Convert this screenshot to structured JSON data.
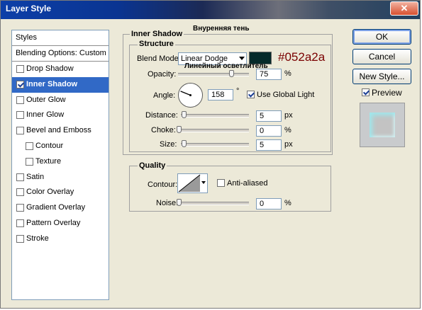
{
  "window": {
    "title": "Layer Style",
    "close_glyph": "✕"
  },
  "styles_list": {
    "header": "Styles",
    "blending_options": "Blending Options: Custom",
    "items": [
      {
        "label": "Drop Shadow",
        "checked": false
      },
      {
        "label": "Inner Shadow",
        "checked": true,
        "selected": true
      },
      {
        "label": "Outer Glow",
        "checked": false
      },
      {
        "label": "Inner Glow",
        "checked": false
      },
      {
        "label": "Bevel and Emboss",
        "checked": false
      },
      {
        "label": "Contour",
        "checked": false,
        "indent": true
      },
      {
        "label": "Texture",
        "checked": false,
        "indent": true
      },
      {
        "label": "Satin",
        "checked": false
      },
      {
        "label": "Color Overlay",
        "checked": false
      },
      {
        "label": "Gradient Overlay",
        "checked": false
      },
      {
        "label": "Pattern Overlay",
        "checked": false
      },
      {
        "label": "Stroke",
        "checked": false
      }
    ]
  },
  "inner_shadow": {
    "title": "Inner Shadow",
    "russian_title": "Внуренняя тень",
    "structure": {
      "title": "Structure",
      "blend_mode_label": "Blend Mode:",
      "blend_mode_value": "Linear Dodge",
      "blend_mode_note": "Линейный осветлитель",
      "shadow_color": "#052a2a",
      "color_annotation": "#052a2a",
      "opacity_label": "Opacity:",
      "opacity_value": "75",
      "opacity_level": 0.75,
      "opacity_unit": "%",
      "angle_label": "Angle:",
      "angle_value": "158",
      "angle_deg": 158,
      "degree_symbol": "°",
      "use_global_light_label": "Use Global Light",
      "use_global_light": true,
      "distance_label": "Distance:",
      "distance_value": "5",
      "distance_unit": "px",
      "choke_label": "Choke:",
      "choke_value": "0",
      "choke_unit": "%",
      "size_label": "Size:",
      "size_value": "5",
      "size_unit": "px"
    },
    "quality": {
      "title": "Quality",
      "contour_label": "Contour:",
      "anti_aliased_label": "Anti-aliased",
      "anti_aliased": false,
      "noise_label": "Noise:",
      "noise_value": "0",
      "noise_unit": "%"
    }
  },
  "buttons": {
    "ok": "OK",
    "cancel": "Cancel",
    "new_style": "New Style..."
  },
  "preview": {
    "label": "Preview",
    "checked": true
  },
  "colors": {
    "annotation_text": "#7a0000",
    "selection": "#3169c6"
  }
}
